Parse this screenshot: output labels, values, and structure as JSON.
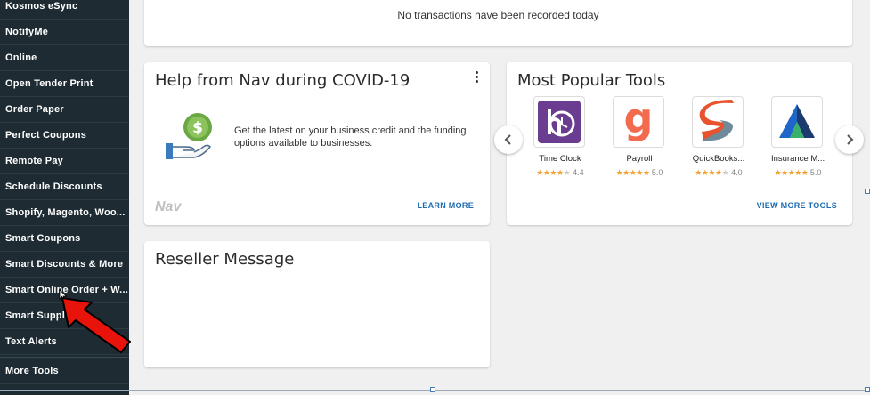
{
  "sidebar": {
    "items": [
      {
        "label": "Kosmos eSync"
      },
      {
        "label": "NotifyMe"
      },
      {
        "label": "Online"
      },
      {
        "label": "Open Tender Print"
      },
      {
        "label": "Order Paper"
      },
      {
        "label": "Perfect Coupons"
      },
      {
        "label": "Remote Pay"
      },
      {
        "label": "Schedule Discounts"
      },
      {
        "label": "Shopify, Magento, Woo..."
      },
      {
        "label": "Smart Coupons"
      },
      {
        "label": "Smart Discounts & More"
      },
      {
        "label": "Smart Online Order + W..."
      },
      {
        "label": "Smart Suppli"
      },
      {
        "label": "Text Alerts"
      }
    ],
    "more_tools": "More Tools"
  },
  "transactions": {
    "message": "No transactions have been recorded today"
  },
  "nav_card": {
    "title": "Help from Nav during COVID-19",
    "body": "Get the latest on your business credit and the funding options available to businesses.",
    "logo": "Nav",
    "learn_more": "LEARN MORE"
  },
  "tools_card": {
    "title": "Most Popular Tools",
    "tools": [
      {
        "name": "Time Clock",
        "rating": "4.4",
        "stars": 4.4,
        "icon": "time-clock-logo",
        "color": "#6a3d91"
      },
      {
        "name": "Payroll",
        "rating": "5.0",
        "stars": 5.0,
        "icon": "payroll-logo",
        "color": "#f26b4e"
      },
      {
        "name": "QuickBooks...",
        "rating": "4.0",
        "stars": 4.0,
        "icon": "quickbooks-sync-logo",
        "color": "#e8532d"
      },
      {
        "name": "Insurance M...",
        "rating": "5.0",
        "stars": 5.0,
        "icon": "insurance-logo",
        "color": "#1f66c8"
      }
    ],
    "view_more": "VIEW MORE TOOLS"
  },
  "reseller": {
    "title": "Reseller Message"
  },
  "colors": {
    "sidebar_bg": "#1e2b33",
    "link": "#1c6bb0",
    "star": "#f0a030",
    "annotation_arrow": "#e8140c"
  }
}
